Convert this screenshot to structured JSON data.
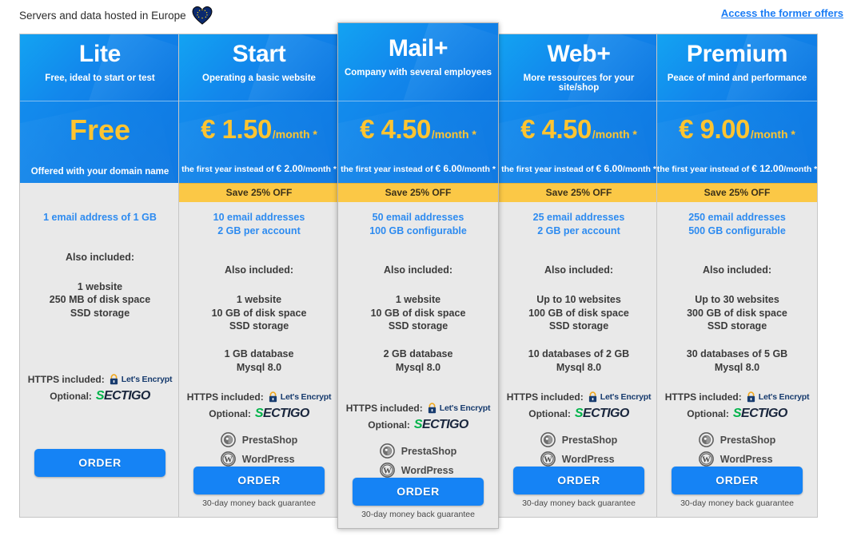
{
  "topbar": {
    "hosting_note": "Servers and data hosted in Europe",
    "eu_icon": "eu-heart-flag-icon",
    "former_offers_link": "Access the former offers"
  },
  "labels": {
    "also_included": "Also included:",
    "https_included": "HTTPS included:",
    "optional": "Optional:",
    "lets_encrypt": "Let's Encrypt",
    "sectigo_s": "S",
    "sectigo_rest": "ECTIGO",
    "prestashop": "PrestaShop",
    "wordpress": "WordPress",
    "order": "ORDER",
    "guarantee": "30-day money back guarantee",
    "save_band": "Save 25% OFF",
    "per_month": "/month *"
  },
  "colors": {
    "accent_blue": "#1583f5",
    "price_gold": "#fdc431",
    "save_band_bg": "#fbc846",
    "email_blue": "#2d8bf0",
    "card_bg": "#e9e9e9",
    "sectigo_green": "#00b34a",
    "lets_encrypt_navy": "#173b6e"
  },
  "plans": [
    {
      "name": "Lite",
      "tagline": "Free, ideal to start or test",
      "price_display": "Free",
      "price_is_free": true,
      "price_sub": "Offered with your domain name",
      "save_band": "",
      "has_save_band": false,
      "email": "1 email address of 1 GB",
      "features": "1 website\n250 MB of disk space\nSSD storage",
      "database": "",
      "has_database": false,
      "has_apps": false,
      "has_guarantee": false,
      "order": "ORDER"
    },
    {
      "name": "Start",
      "tagline": "Operating a basic website",
      "price_amount": "€ 1.50",
      "price_per": "/month *",
      "price_is_free": false,
      "price_sub_prefix": "the first year instead of ",
      "price_sub_strike": "€ 2.00",
      "price_sub_suffix": "/month *",
      "save_band": "Save 25% OFF",
      "has_save_band": true,
      "email": "10 email addresses\n2 GB per account",
      "features": "1 website\n10 GB of disk space\nSSD storage",
      "database": "1 GB database\nMysql 8.0",
      "has_database": true,
      "has_apps": true,
      "has_guarantee": true,
      "order": "ORDER"
    },
    {
      "name": "Mail+",
      "tagline": "Company with several employees",
      "price_amount": "€ 4.50",
      "price_per": "/month *",
      "price_is_free": false,
      "price_sub_prefix": "the first year instead of ",
      "price_sub_strike": "€ 6.00",
      "price_sub_suffix": "/month *",
      "save_band": "Save 25% OFF",
      "has_save_band": true,
      "email": "50 email addresses\n100 GB configurable",
      "features": "1 website\n10 GB of disk space\nSSD storage",
      "database": "2 GB database\nMysql 8.0",
      "has_database": true,
      "has_apps": true,
      "has_guarantee": true,
      "featured": true,
      "order": "ORDER"
    },
    {
      "name": "Web+",
      "tagline": "More ressources for your site/shop",
      "price_amount": "€ 4.50",
      "price_per": "/month *",
      "price_is_free": false,
      "price_sub_prefix": "the first year instead of ",
      "price_sub_strike": "€ 6.00",
      "price_sub_suffix": "/month *",
      "save_band": "Save 25% OFF",
      "has_save_band": true,
      "email": "25 email addresses\n2 GB per account",
      "features": "Up to 10 websites\n100 GB of disk space\nSSD storage",
      "database": "10 databases of 2 GB\nMysql 8.0",
      "has_database": true,
      "has_apps": true,
      "has_guarantee": true,
      "order": "ORDER"
    },
    {
      "name": "Premium",
      "tagline": "Peace of mind and performance",
      "price_amount": "€ 9.00",
      "price_per": "/month *",
      "price_is_free": false,
      "price_sub_prefix": "the first year instead of ",
      "price_sub_strike": "€ 12.00",
      "price_sub_suffix": "/month *",
      "save_band": "Save 25% OFF",
      "has_save_band": true,
      "email": "250 email addresses\n500 GB configurable",
      "features": "Up to 30 websites\n300 GB of disk space\nSSD storage",
      "database": "30 databases of 5 GB\nMysql 8.0",
      "has_database": true,
      "has_apps": true,
      "has_guarantee": true,
      "order": "ORDER"
    }
  ]
}
